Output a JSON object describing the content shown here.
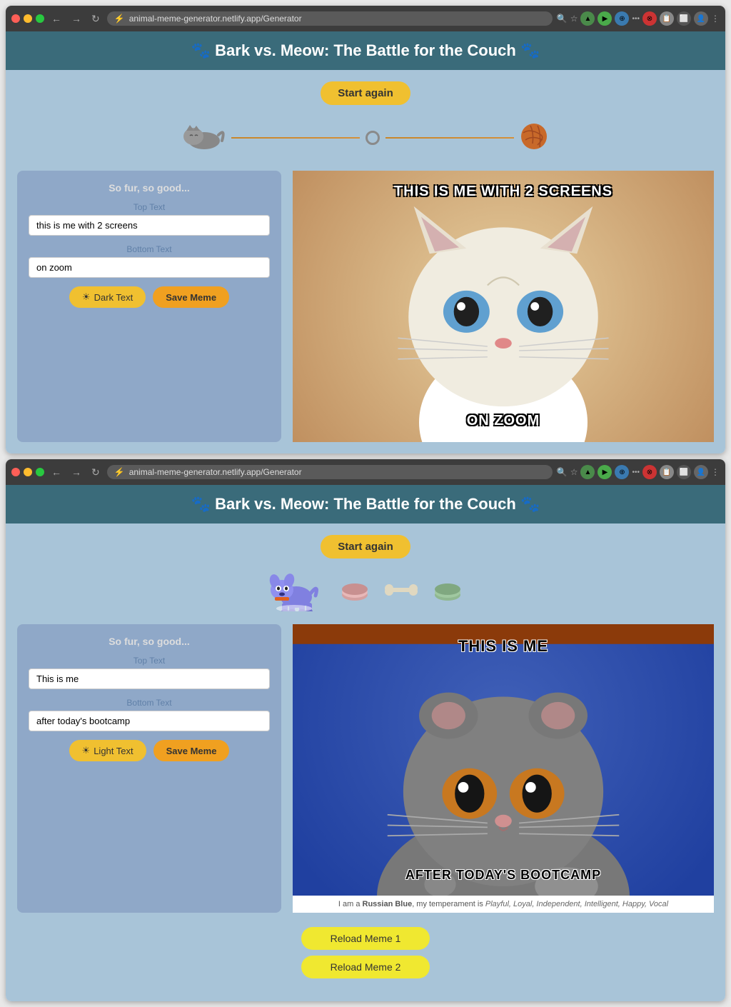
{
  "browser1": {
    "url": "animal-meme-generator.netlify.app/Generator",
    "header": {
      "title": "🐾 Bark vs. Meow: The Battle for the Couch 🐾"
    },
    "startAgain": "Start again",
    "form": {
      "subtitle": "So fur, so good...",
      "topTextLabel": "Top Text",
      "topTextValue": "this is me with 2 screens",
      "topTextPlaceholder": "Top Text",
      "bottomTextLabel": "Bottom Text",
      "bottomTextValue": "on zoom",
      "bottomTextPlaceholder": "Bottom Text",
      "darkTextBtn": "Dark Text",
      "saveMemeBtn": "Save Meme"
    },
    "meme": {
      "topText": "THIS IS ME WITH 2 SCREENS",
      "bottomText": "ON ZOOM",
      "animalType": "white cat"
    }
  },
  "browser2": {
    "url": "animal-meme-generator.netlify.app/Generator",
    "header": {
      "title": "🐾 Bark vs. Meow: The Battle for the Couch 🐾"
    },
    "startAgain": "Start again",
    "form": {
      "subtitle": "So fur, so good...",
      "topTextLabel": "Top Text",
      "topTextValue": "This is me",
      "topTextPlaceholder": "Top Text",
      "bottomTextLabel": "Bottom Text",
      "bottomTextValue": "after today's bootcamp",
      "bottomTextPlaceholder": "Bottom Text",
      "lightTextBtn": "Light -",
      "lightTextBtnFull": "Light Text",
      "saveMemeBtn": "Save Meme"
    },
    "meme": {
      "topText": "THIS IS ME",
      "bottomText": "AFTER TODAY'S BOOTCAMP",
      "animalType": "Russian Blue",
      "caption": "I am a ",
      "captionBold": "Russian Blue",
      "captionItalic": "Playful, Loyal, Independent, Intelligent, Happy, Vocal",
      "captionMid": ", my temperament is "
    },
    "reloadBtn1": "Reload Meme 1",
    "reloadBtn2": "Reload Meme 2"
  },
  "icons": {
    "paw": "🐾",
    "sun": "☀",
    "cat_sleeping": "😾",
    "yarn": "🧶",
    "dog": "🐕",
    "bowl": "🥣",
    "bone": "🦴"
  }
}
